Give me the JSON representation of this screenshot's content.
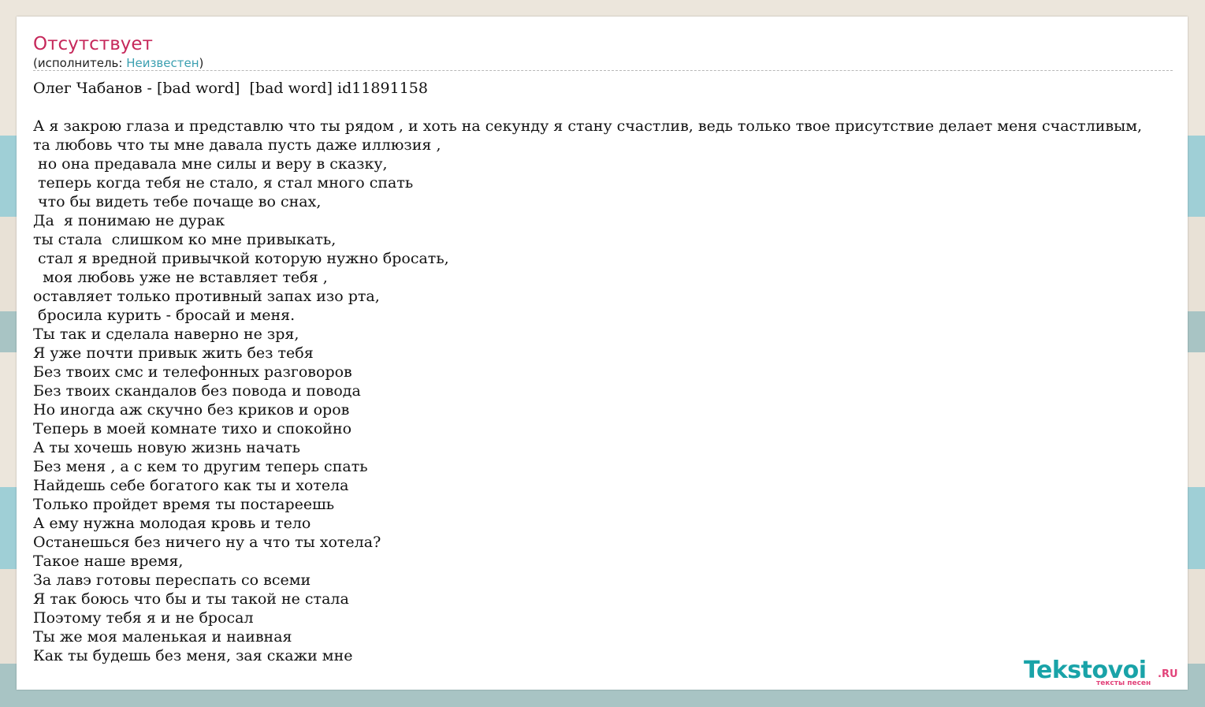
{
  "song": {
    "title": "Отсутствует",
    "artist_prefix": "(исполнитель: ",
    "artist_name": "Неизвестен",
    "artist_suffix": ")"
  },
  "lyrics": {
    "heading": "Олег Чабанов - [bad word]  [bad word] id11891158",
    "lines": [
      "А я закрою глаза и представлю что ты рядом , и хоть на секунду я стану счастлив, ведь только твое присутствие делает меня счастливым,",
      "та любовь что ты мне давала пусть даже иллюзия ,",
      " но она предавала мне силы и веру в сказку,",
      " теперь когда тебя не стало, я стал много спать",
      " что бы видеть тебе почаще во снах,",
      "Да  я понимаю не дурак",
      "ты стала  слишком ко мне привыкать,",
      " стал я вредной привычкой которую нужно бросать,",
      "  моя любовь уже не вставляет тебя ,",
      "оставляет только противный запах изо рта,",
      " бросила курить - бросай и меня.",
      "Ты так и сделала наверно не зря,",
      "Я уже почти привык жить без тебя",
      "Без твоих смс и телефонных разговоров",
      "Без твоих скандалов без повода и повода",
      "Но иногда аж скучно без криков и оров",
      "Теперь в моей комнате тихо и спокойно",
      "А ты хочешь новую жизнь начать",
      "Без меня , а с кем то другим теперь спать",
      "Найдешь себе богатого как ты и хотела",
      "Только пройдет время ты постареешь",
      "А ему нужна молодая кровь и тело",
      "Останешься без ничего ну а что ты хотела?",
      "Такое наше время,",
      "За лавэ готовы переспать со всеми",
      "Я так боюсь что бы и ты такой не стала",
      "Поэтому тебя я и не бросал",
      "Ты же моя маленькая и наивная",
      "Как ты будешь без меня, зая скажи мне"
    ]
  },
  "logo": {
    "main": "Tekstovoi",
    "domain": ".RU",
    "tagline": "тексты песен"
  },
  "colors": {
    "title": "#c6285b",
    "link": "#3a9fb0",
    "logo_primary": "#19a3a8",
    "logo_accent": "#e2437a"
  }
}
